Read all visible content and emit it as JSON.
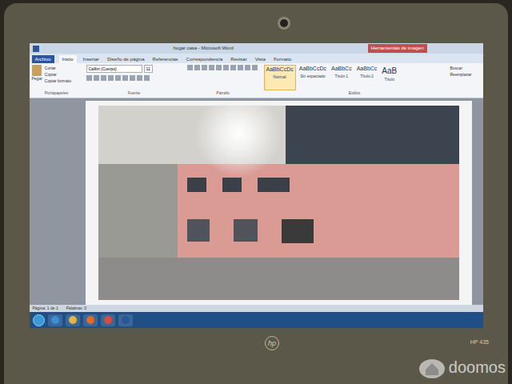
{
  "window": {
    "title": "hogar casa - Microsoft Word"
  },
  "contextual_tab": {
    "label": "Herramientas de imagen"
  },
  "tabs": [
    {
      "label": "Archivo",
      "selected": false
    },
    {
      "label": "Inicio",
      "selected": true
    },
    {
      "label": "Insertar",
      "selected": false
    },
    {
      "label": "Diseño de página",
      "selected": false
    },
    {
      "label": "Referencias",
      "selected": false
    },
    {
      "label": "Correspondencia",
      "selected": false
    },
    {
      "label": "Revisar",
      "selected": false
    },
    {
      "label": "Vista",
      "selected": false
    },
    {
      "label": "Formato",
      "selected": false
    }
  ],
  "clipboard": {
    "paste": "Pegar",
    "items": [
      "Cortar",
      "Copiar",
      "Copiar formato"
    ],
    "group": "Portapapeles"
  },
  "font": {
    "name": "Calibri (Cuerpo)",
    "size": "11",
    "group": "Fuente"
  },
  "paragraph": {
    "group": "Párrafo"
  },
  "styles": {
    "group": "Estilos",
    "items": [
      {
        "sample": "AaBbCcDc",
        "name": "Normal",
        "selected": true
      },
      {
        "sample": "AaBbCcDc",
        "name": "Sin espaciado",
        "selected": false
      },
      {
        "sample": "AaBbCc",
        "name": "Título 1",
        "selected": false
      },
      {
        "sample": "AaBbCc",
        "name": "Título 2",
        "selected": false
      },
      {
        "sample": "AaB",
        "name": "Título",
        "selected": false
      }
    ]
  },
  "editing": [
    "Buscar",
    "Reemplazar"
  ],
  "status_bar": [
    "Página: 1 de 1",
    "Palabras: 0"
  ],
  "laptop": {
    "brand": "hp",
    "model": "HP 435"
  },
  "watermark": "doomos"
}
